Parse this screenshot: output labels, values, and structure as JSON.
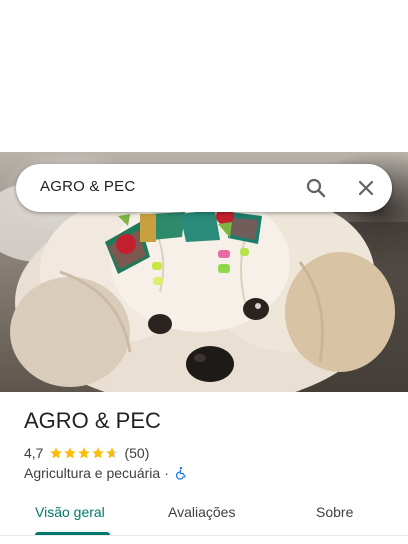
{
  "search": {
    "query": "AGRO & PEC"
  },
  "place": {
    "name": "AGRO & PEC",
    "rating": "4,7",
    "rating_value": 4.7,
    "review_count": "(50)",
    "category": "Agricultura e pecuária",
    "separator": "·"
  },
  "tabs": [
    {
      "label": "Visão geral",
      "active": true
    },
    {
      "label": "Avaliações",
      "active": false
    },
    {
      "label": "Sobre",
      "active": false
    }
  ],
  "colors": {
    "accent": "#00796b",
    "star": "#fbbc04",
    "accessibility": "#1a73e8"
  },
  "icons": {
    "search": "search-icon",
    "close": "close-icon",
    "accessibility": "wheelchair-icon"
  }
}
